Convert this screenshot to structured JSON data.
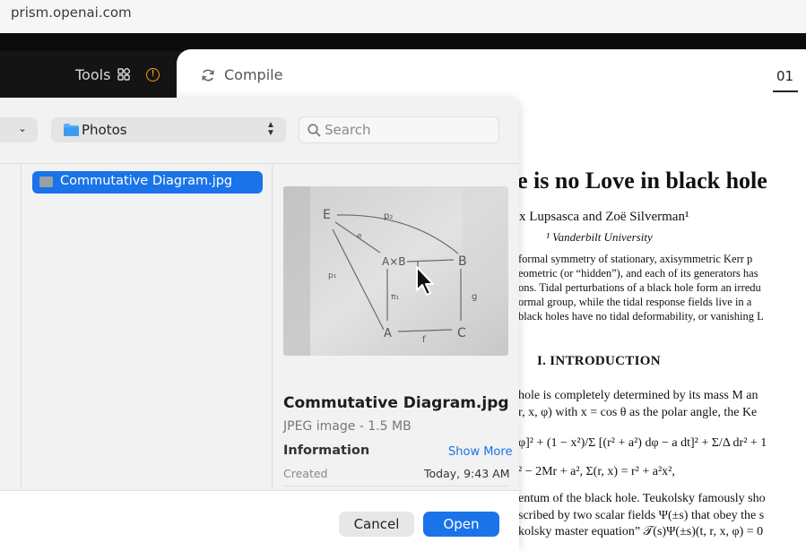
{
  "browser": {
    "url": "prism.openai.com"
  },
  "toolbar": {
    "tools_label": "Tools",
    "warning_symbol": "!"
  },
  "editor": {
    "compile_label": "Compile",
    "page_tab": "01"
  },
  "pdf": {
    "title": "e is no Love in black hole",
    "authors": "x Lupsasca and Zoë Silverman¹",
    "affiliation": "¹ Vanderbilt  University",
    "abstract_lines": [
      "formal symmetry of stationary, axisymmetric Kerr p",
      "eometric (or “hidden”), and each of its generators has",
      "ons. Tidal perturbations of a black hole form an irredu",
      "ormal group, while the tidal response fields live in a",
      "black holes have no tidal deformability, or vanishing L"
    ],
    "section": "I.   INTRODUCTION",
    "body_lines": [
      "hole is completely determined by its mass M an",
      "r, x, φ) with x = cos θ as the polar angle, the Ke",
      "φ]² + (1 − x²)/Σ [(r² + a²) dφ − a dt]² + Σ/Δ dr² + 1",
      "² − 2Mr + a²,      Σ(r, x) = r² + a²x²,",
      "entum of the black hole. Teukolsky famously sho",
      "scribed by two scalar fields Ψ(±s) that obey the s",
      "kolsky master equation” 𝒯(s)Ψ(±s)(t, r, x, φ) = 0"
    ]
  },
  "dialog": {
    "location": "Photos",
    "search_placeholder": "Search",
    "selected_file": "Commutative Diagram.jpg",
    "preview": {
      "name": "Commutative Diagram.jpg",
      "kind": "JPEG image - 1.5 MB",
      "info_heading": "Information",
      "show_more": "Show More",
      "created_label": "Created",
      "created_value": "Today, 9:43 AM"
    },
    "diagram_labels": {
      "E": "E",
      "AxB": "A×B",
      "B": "B",
      "A": "A",
      "C": "C",
      "p2": "p₂",
      "e": "e",
      "p1": "p₁",
      "pi1": "π₁",
      "pi2": "π₂",
      "g": "g",
      "f": "f"
    },
    "cancel_label": "Cancel",
    "open_label": "Open"
  },
  "colors": {
    "accent": "#1a73e8",
    "warning": "#ff9f0a"
  }
}
